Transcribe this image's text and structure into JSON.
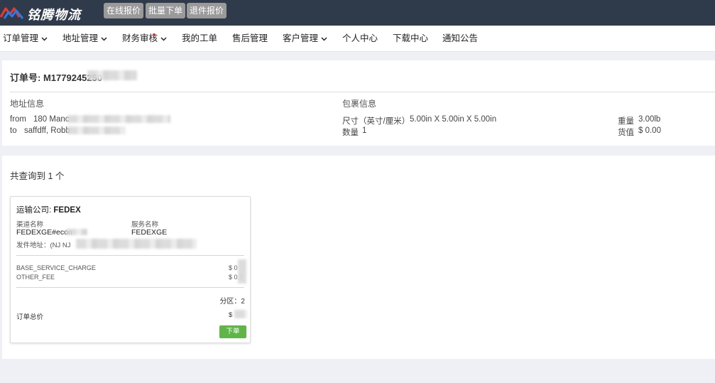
{
  "brand": {
    "name": "铭腾物流"
  },
  "topbar": {
    "buttons": [
      "在线报价",
      "批量下单",
      "退件报价"
    ]
  },
  "nav": {
    "items": [
      {
        "label": "订单管理",
        "dropdown": true
      },
      {
        "label": "地址管理",
        "dropdown": true
      },
      {
        "label": "财务审核",
        "dropdown": true,
        "dot": true
      },
      {
        "label": "我的工单",
        "dropdown": false
      },
      {
        "label": "售后管理",
        "dropdown": false
      },
      {
        "label": "客户管理",
        "dropdown": true
      },
      {
        "label": "个人中心",
        "dropdown": false
      },
      {
        "label": "下载中心",
        "dropdown": false
      },
      {
        "label": "通知公告",
        "dropdown": false
      }
    ]
  },
  "order": {
    "number_label": "订单号:",
    "number_value": "M1779245250",
    "address_section": "地址信息",
    "package_section": "包裹信息",
    "from_label": "from",
    "from_value": "180 Manc",
    "to_label": "to",
    "to_value": "saffdff, Robb",
    "size_label": "尺寸（英寸/厘米）",
    "size_value": "5.00in X 5.00in X 5.00in",
    "qty_label": "数量",
    "qty_value": "1",
    "weight_label": "重量",
    "weight_value": "3.00lb",
    "goods_value_label": "货值",
    "goods_value": "$ 0.00"
  },
  "results": {
    "count_text": "共查询到 1 个",
    "quotes": [
      {
        "carrier_label": "运输公司:",
        "carrier_value": "FEDEX",
        "channel_label": "渠道名称",
        "channel_value": "FEDEXGE#econ",
        "service_label": "服务名称",
        "service_value": "FEDEXGE",
        "ship_from_label": "发件地址：(NJ NJ",
        "fees": [
          {
            "name": "BASE_SERVICE_CHARGE",
            "amount": "$ 0"
          },
          {
            "name": "OTHER_FEE",
            "amount": "$ 0.7"
          }
        ],
        "zone_text": "分区：2",
        "total_label": "订单总价",
        "total_value": "$",
        "order_button": "下单"
      }
    ]
  },
  "colors": {
    "topbar": "#2f3a4a",
    "top_button": "#9a9a9a",
    "order_button": "#5fb547",
    "page_bg": "#eef0f6"
  },
  "icons": [
    "logo-icon",
    "chevron-down-icon",
    "notification-dot-icon"
  ]
}
